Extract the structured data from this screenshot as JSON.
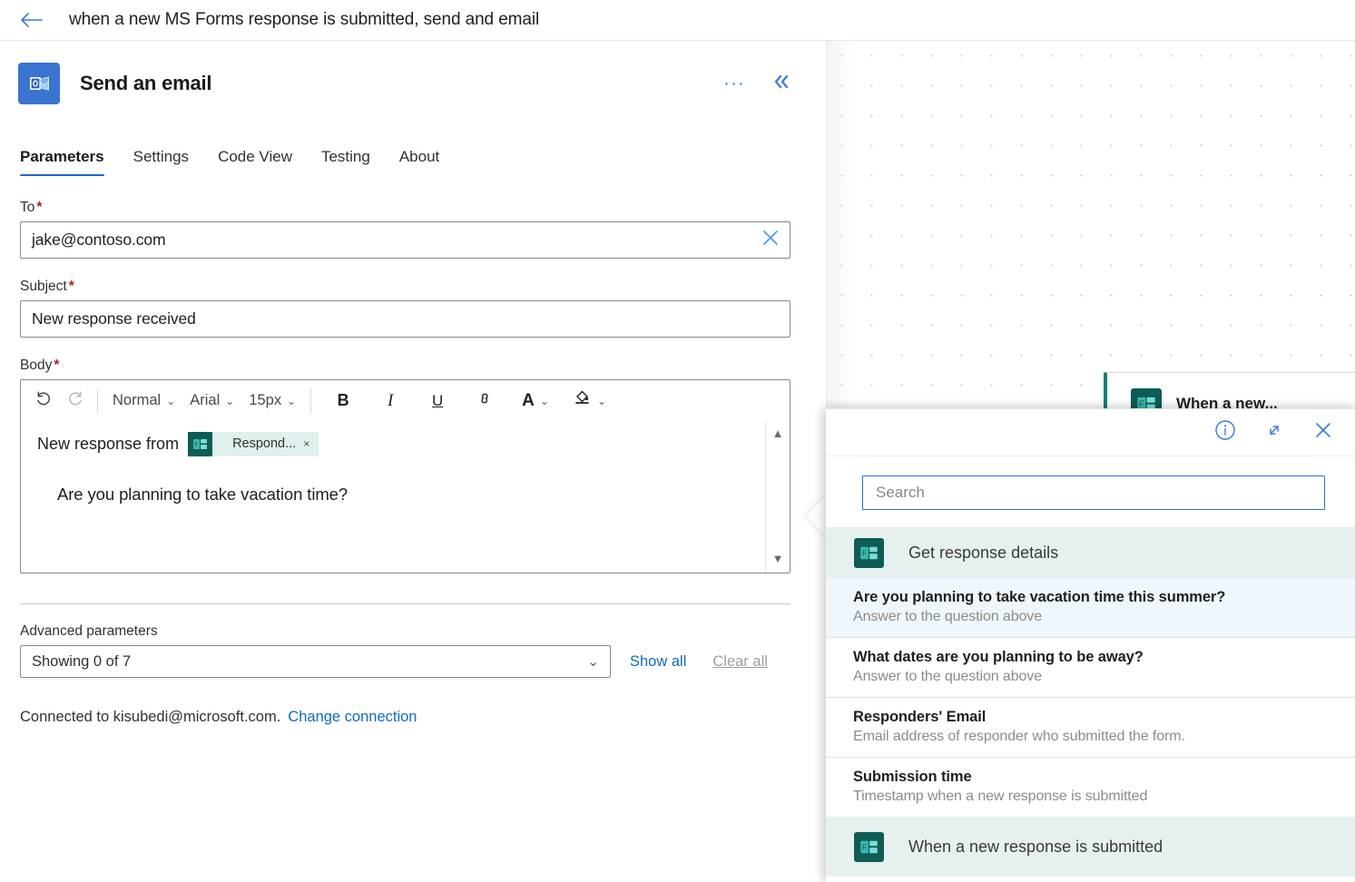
{
  "topbar": {
    "back_icon": "back-arrow-icon",
    "flow_title": "when a new MS Forms response is submitted, send and email"
  },
  "card": {
    "app_icon": "outlook-icon",
    "title": "Send an email",
    "more_label": "···",
    "more_icon": "ellipsis-icon",
    "collapse_icon": "double-chevron-left-icon"
  },
  "tabs": [
    {
      "label": "Parameters",
      "active": true
    },
    {
      "label": "Settings",
      "active": false
    },
    {
      "label": "Code View",
      "active": false
    },
    {
      "label": "Testing",
      "active": false
    },
    {
      "label": "About",
      "active": false
    }
  ],
  "fields": {
    "to": {
      "label": "To",
      "required_mark": "*",
      "value": "jake@contoso.com",
      "clear_icon": "close-x-icon"
    },
    "subject": {
      "label": "Subject",
      "required_mark": "*",
      "value": "New response received"
    },
    "body": {
      "label": "Body",
      "required_mark": "*"
    }
  },
  "rte_toolbar": {
    "undo_icon": "undo-icon",
    "redo_icon": "redo-icon",
    "style_value": "Normal",
    "font_value": "Arial",
    "size_value": "15px",
    "bold_label": "B",
    "italic_label": "I",
    "underline_label": "U",
    "link_icon": "link-icon",
    "font_color_label": "A",
    "font_color_icon": "font-color-icon",
    "highlight_icon": "highlight-fill-icon"
  },
  "rte_body": {
    "line1_text": "New response from",
    "token_label": "Respond...",
    "token_icon": "ms-forms-icon",
    "token_remove": "×",
    "paragraph": "Are you planning to take vacation time?",
    "scroll_up": "▲",
    "scroll_down": "▼"
  },
  "advanced": {
    "section_label": "Advanced parameters",
    "select_value": "Showing 0 of 7",
    "chevron_icon": "chevron-down-icon",
    "show_all_label": "Show all",
    "clear_all_label": "Clear all"
  },
  "connection": {
    "text": "Connected to kisubedi@microsoft.com.",
    "change_link": "Change connection"
  },
  "canvas": {
    "node": {
      "icon": "ms-forms-icon",
      "title": "When a new..."
    }
  },
  "flyout": {
    "info_icon": "info-circle-icon",
    "expand_icon": "expand-diagonal-icon",
    "close_icon": "close-x-icon",
    "search": {
      "placeholder": "Search",
      "value": ""
    },
    "groups": [
      {
        "icon": "ms-forms-icon",
        "label": "Get response details",
        "items": [
          {
            "title": "Are you planning to take vacation time this summer?",
            "subtitle": "Answer to the question above",
            "selected": true
          },
          {
            "title": "What dates are you planning to be away?",
            "subtitle": "Answer to the question above",
            "selected": false
          },
          {
            "title": "Responders' Email",
            "subtitle": "Email address of responder who submitted the form.",
            "selected": false
          },
          {
            "title": "Submission time",
            "subtitle": "Timestamp when a new response is submitted",
            "selected": false
          }
        ]
      },
      {
        "icon": "ms-forms-icon",
        "label": "When a new response is submitted",
        "items": []
      }
    ]
  },
  "colors": {
    "accent_blue": "#0f6cbd",
    "tab_underline": "#2266cc",
    "required_red": "#a4262c",
    "forms_teal": "#0f5c54",
    "group_bg": "#e6f1ef",
    "selected_bg": "#eff6fc",
    "outlook_blue": "#3a74d0"
  }
}
